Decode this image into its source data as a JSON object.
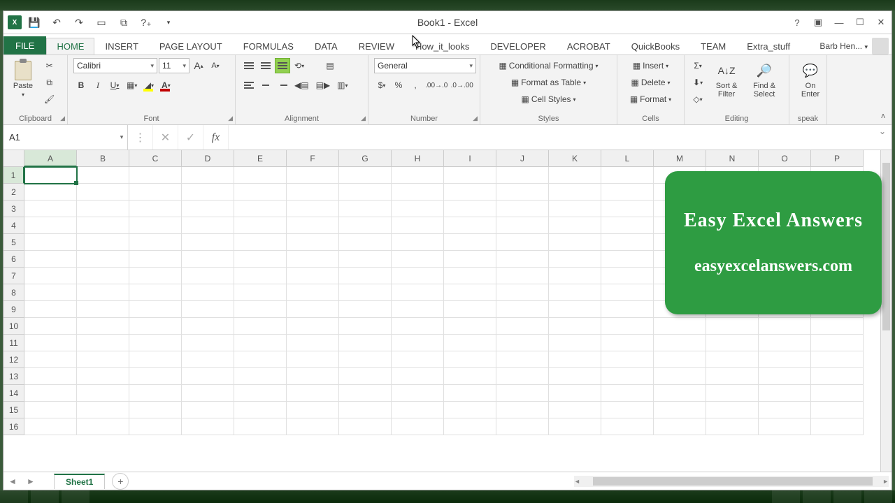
{
  "title": "Book1 - Excel",
  "qat": {
    "excel": "X"
  },
  "tabs": [
    "FILE",
    "HOME",
    "INSERT",
    "PAGE LAYOUT",
    "FORMULAS",
    "DATA",
    "REVIEW",
    "How_it_looks",
    "DEVELOPER",
    "ACROBAT",
    "QuickBooks",
    "TEAM",
    "Extra_stuff"
  ],
  "active_tab": "HOME",
  "user": "Barb Hen...",
  "ribbon": {
    "clipboard": {
      "label": "Clipboard",
      "paste": "Paste"
    },
    "font": {
      "label": "Font",
      "name": "Calibri",
      "size": "11",
      "bold": "B",
      "italic": "I",
      "underline": "U",
      "grow": "A",
      "shrink": "A"
    },
    "alignment": {
      "label": "Alignment"
    },
    "number": {
      "label": "Number",
      "format": "General",
      "currency": "$",
      "percent": "%",
      "comma": ","
    },
    "styles": {
      "label": "Styles",
      "cond": "Conditional Formatting",
      "table": "Format as Table",
      "cell": "Cell Styles"
    },
    "cells": {
      "label": "Cells",
      "insert": "Insert",
      "delete": "Delete",
      "format": "Format"
    },
    "editing": {
      "label": "Editing",
      "sort": "Sort & Filter",
      "find": "Find & Select"
    },
    "speak": {
      "label": "speak",
      "btn": "On Enter"
    }
  },
  "namebox": "A1",
  "columns": [
    "A",
    "B",
    "C",
    "D",
    "E",
    "F",
    "G",
    "H",
    "I",
    "J",
    "K",
    "L",
    "M",
    "N",
    "O",
    "P"
  ],
  "rows": [
    "1",
    "2",
    "3",
    "4",
    "5",
    "6",
    "7",
    "8",
    "9",
    "10",
    "11",
    "12",
    "13",
    "14",
    "15",
    "16"
  ],
  "sheet_tab": "Sheet1",
  "overlay": {
    "line1": "Easy Excel Answers",
    "line2": "easyexcelanswers.com"
  }
}
